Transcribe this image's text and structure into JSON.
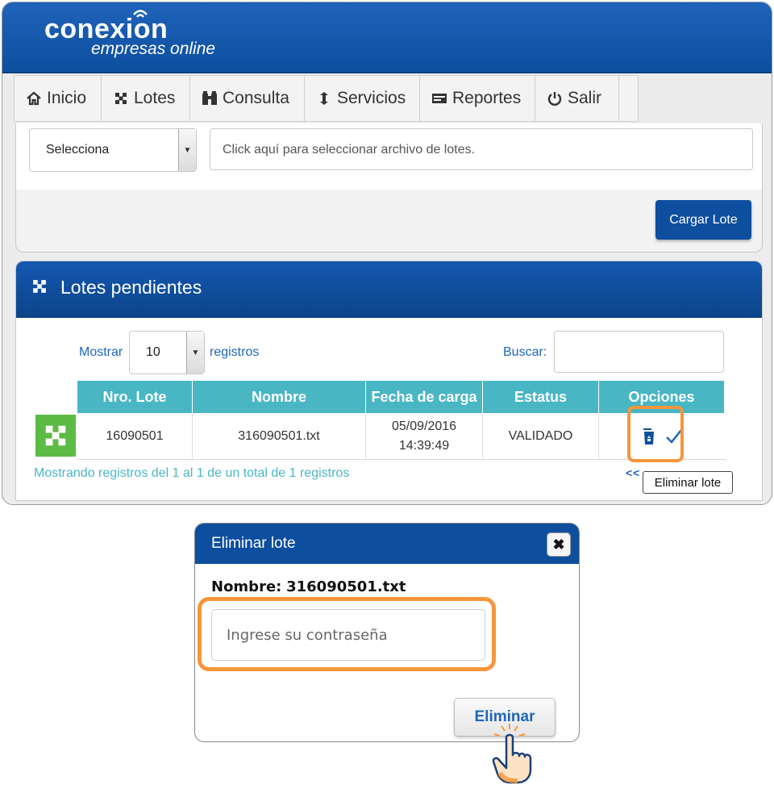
{
  "brand": {
    "name": "conexion",
    "tagline": "empresas online"
  },
  "nav": {
    "items": [
      {
        "label": "Inicio",
        "icon": "home-icon"
      },
      {
        "label": "Lotes",
        "icon": "lotes-icon"
      },
      {
        "label": "Consulta",
        "icon": "binoculars-icon"
      },
      {
        "label": "Servicios",
        "icon": "servicios-icon"
      },
      {
        "label": "Reportes",
        "icon": "reports-icon"
      },
      {
        "label": "Salir",
        "icon": "power-icon"
      }
    ]
  },
  "upload": {
    "select_value": "Selecciona",
    "file_placeholder": "Click aquí para seleccionar archivo de lotes.",
    "upload_button": "Cargar Lote"
  },
  "pending": {
    "title": "Lotes pendientes",
    "show_label": "Mostrar",
    "show_value": "10",
    "records_label": "registros",
    "search_label": "Buscar:",
    "columns": [
      "Nro. Lote",
      "Nombre",
      "Fecha de carga",
      "Estatus",
      "Opciones"
    ],
    "rows": [
      {
        "nro": "16090501",
        "nombre": "316090501.txt",
        "fecha": "05/09/2016",
        "hora": "14:39:49",
        "estatus": "VALIDADO"
      }
    ],
    "info": "Mostrando registros del 1 al 1 de un total de 1 registros",
    "pager": "<<",
    "tooltip": "Eliminar lote"
  },
  "modal": {
    "title": "Eliminar lote",
    "close": "✖",
    "name_label": "Nombre:",
    "name_value": "316090501.txt",
    "password_placeholder": "Ingrese su contraseña",
    "delete_button": "Eliminar"
  },
  "colors": {
    "primary": "#0d4f9e",
    "teal": "#49b6c4",
    "highlight": "#f7963a",
    "green": "#5cbb45"
  }
}
